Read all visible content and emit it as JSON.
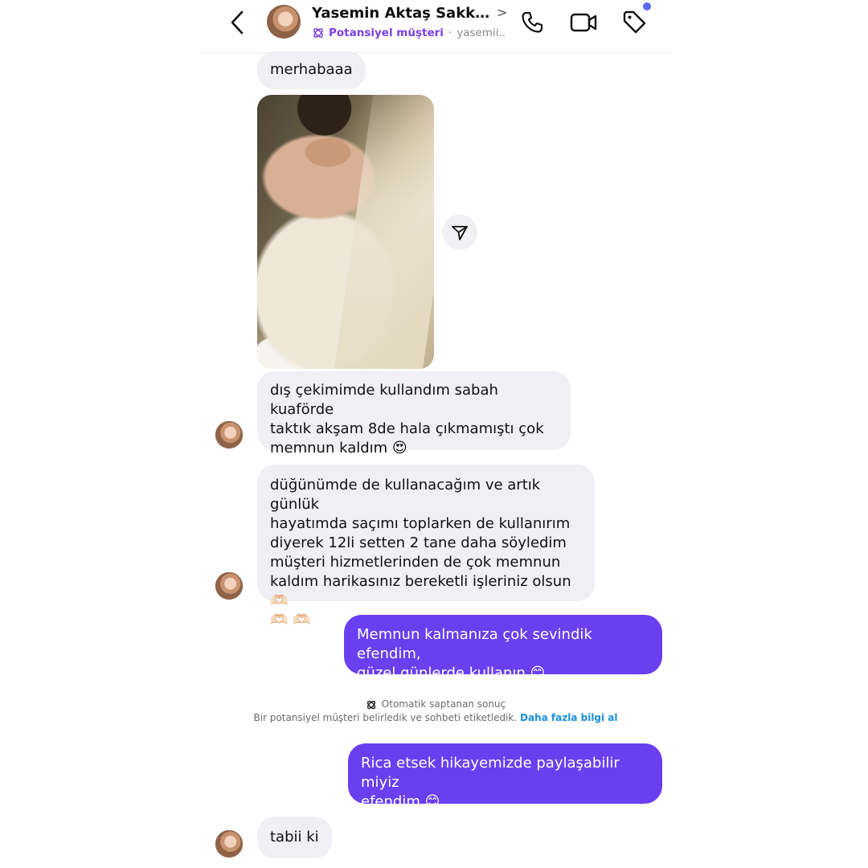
{
  "header": {
    "contact_name": "Yasemin Aktaş Sakkao...",
    "chevron": ">",
    "lead_label": "Potansiyel müşteri",
    "separator": "·",
    "username": "yasemii..."
  },
  "messages": [
    {
      "direction": "incoming",
      "text": "merhabaaa"
    },
    {
      "direction": "incoming",
      "type": "image",
      "description_icon": "bride-photo"
    },
    {
      "direction": "incoming",
      "text": "dış çekimimde kullandım sabah kuaförde\ntaktık akşam 8de hala çıkmamıştı çok\nmemnun kaldım 😍"
    },
    {
      "direction": "incoming",
      "text": "düğünümde de kullanacağım ve artık günlük\nhayatımda saçımı toplarken de kullanırım\ndiyerek 12li setten 2 tane daha söyledim\nmüşteri hizmetlerinden de çok memnun\nkaldım harikasınız bereketli işleriniz olsun 🫶🏻\n🫶🏻 🫶🏻"
    },
    {
      "direction": "outgoing",
      "text": "Memnun kalmanıza çok sevindik efendim,\ngüzel günlerde kullanın 😊"
    },
    {
      "direction": "outgoing",
      "text": "Rica etsek hikayemizde paylaşabilir miyiz\nefendim 😊"
    },
    {
      "direction": "incoming",
      "text": "tabii ki"
    }
  ],
  "notice": {
    "title": "Otomatik saptanan sonuç",
    "body": "Bir potansiyel müşteri belirledik ve sohbeti etiketledik.",
    "link": "Daha fazla bilgi al"
  },
  "colors": {
    "outgoing_bubble": "#6a3ff0",
    "incoming_bubble": "#efeff4",
    "lead_accent": "#7b3fe4",
    "link": "#1a8fd8",
    "notification_dot": "#5b6cf0"
  },
  "icons": [
    "back-chevron-icon",
    "lead-badge-icon",
    "phone-icon",
    "video-camera-icon",
    "tag-icon",
    "send-share-icon",
    "avatar"
  ]
}
